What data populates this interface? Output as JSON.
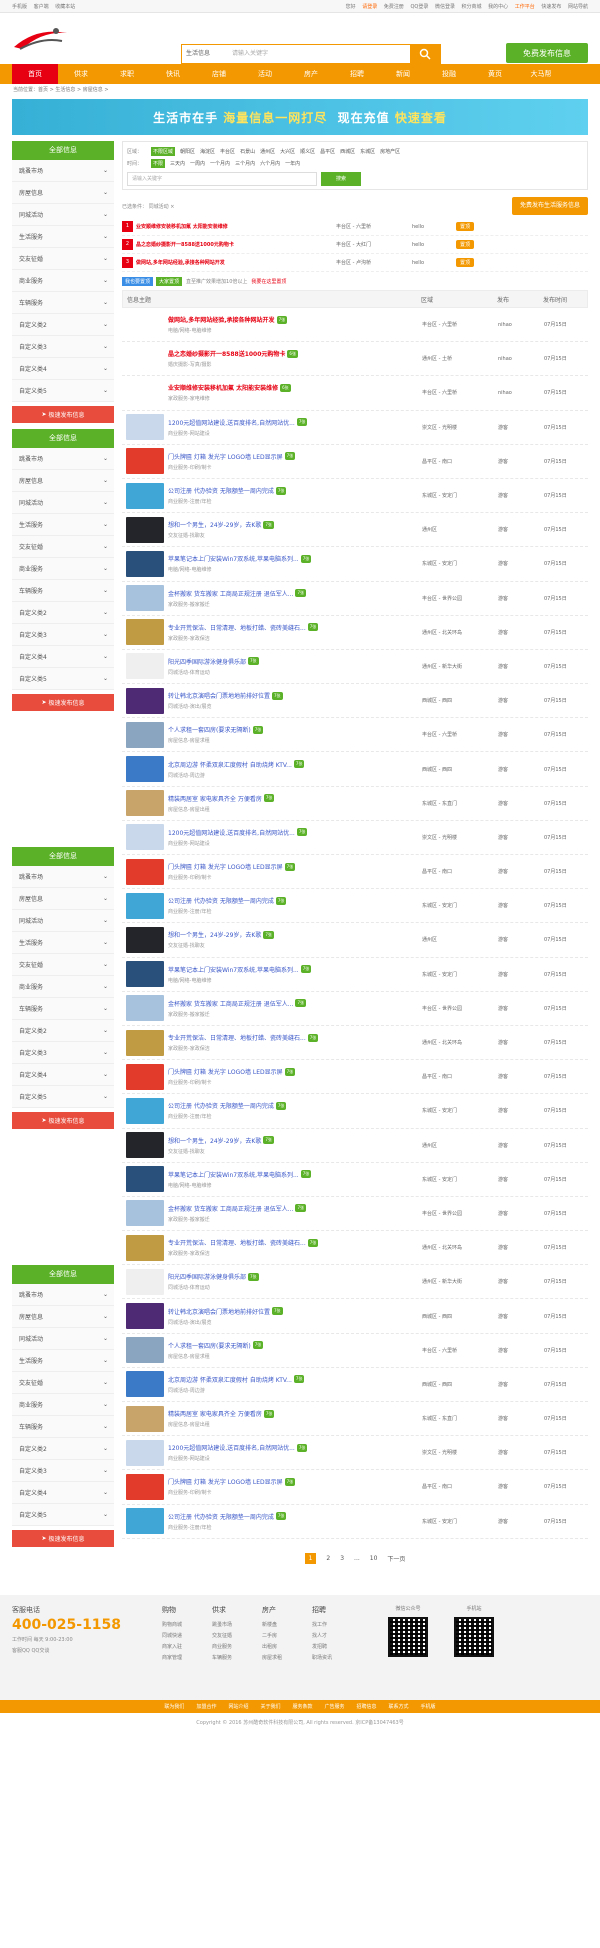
{
  "topbar": {
    "links": [
      "手机版",
      "客户端",
      "收藏本站"
    ],
    "right_links": [
      "您好",
      "请登录",
      "免费注册",
      "QQ登录",
      "微信登录",
      "积分商城",
      "我的中心",
      "工作平台",
      "快速发布",
      "网站导航"
    ]
  },
  "search": {
    "category": "生活信息",
    "placeholder": "请输入关键字"
  },
  "publish_top": "免费发布信息",
  "nav": [
    "首页",
    "供求",
    "求职",
    "快讯",
    "店铺",
    "活动",
    "房产",
    "招聘",
    "新闻",
    "投融",
    "黄页",
    "大马帮"
  ],
  "breadcrumb": "当前位置：首页 > 生活信息 > 房屋信息 >",
  "banner": {
    "a": "生活市在手",
    "b": "海量信息一网打尽",
    "c": "现在充值",
    "d": "快速查看"
  },
  "sidebar": {
    "head": "全部信息",
    "items": [
      "跳蚤市场",
      "房屋信息",
      "同城活动",
      "生活服务",
      "交友征婚",
      "商业服务",
      "车辆服务",
      "自定义类2",
      "自定义类3",
      "自定义类4",
      "自定义类5"
    ],
    "cta": "极速发布信息"
  },
  "filter": {
    "area_label": "区域：",
    "areas": [
      "不限区域",
      "朝阳区",
      "海淀区",
      "丰台区",
      "石景山",
      "通州区",
      "大兴区",
      "顺义区",
      "昌平区",
      "西城区",
      "东城区",
      "房地产区"
    ],
    "time_label": "时间：",
    "times": [
      "不限",
      "三天内",
      "一周内",
      "一个月内",
      "三个月内",
      "六个月内",
      "一年内"
    ],
    "search_placeholder": "请输入关键字",
    "search_button": "搜索"
  },
  "selected": {
    "label": "已选条件：",
    "value": "同城活动 ×"
  },
  "publish_cta": "免费发布生活服务信息",
  "top_rows": [
    {
      "n": "1",
      "title": "业安顺维修安装移机加氟 太阳能安装维修",
      "area": "丰台区 - 六里桥",
      "user": "hello",
      "pill": "置顶"
    },
    {
      "n": "2",
      "title": "晶之恋婚纱摄影开一8588送1000元购物卡",
      "area": "丰台区 - 大红门",
      "user": "hello",
      "pill": "置顶"
    },
    {
      "n": "3",
      "title": "做网站,多年网站经验,承接各种网站开发",
      "area": "丰台区 - 卢沟桥",
      "user": "hello",
      "pill": "置顶"
    }
  ],
  "ads": {
    "b1": "我也要置顶",
    "b2": "大家置顶",
    "hint": "直至推广效果增加10倍以上",
    "link": "我要在这里置顶"
  },
  "table_head": [
    "信息主题",
    "区域",
    "发布",
    "发布时间"
  ],
  "rows": [
    {
      "title": "做网站,多年网站经验,承接各种网站开发",
      "sub": "电脑/网络-电脑维修",
      "area": "丰台区 - 六里桥",
      "user": "nihao",
      "date": "07月15日",
      "hot": true,
      "tag": "7张",
      "color": "#ffffff"
    },
    {
      "title": "晶之恋婚纱摄影开一8588送1000元购物卡",
      "sub": "婚庆摄影-写真/摄影",
      "area": "通州区 - 土桥",
      "user": "nihao",
      "date": "07月15日",
      "hot": true,
      "tag": "6张",
      "color": "#ffffff"
    },
    {
      "title": "业安顺维修安装移机加氟 太阳能安装维修",
      "sub": "家政服务-家电维修",
      "area": "丰台区 - 六里桥",
      "user": "nihao",
      "date": "07月15日",
      "hot": true,
      "tag": "6张",
      "color": "#ffffff"
    },
    {
      "title": "1200元超值网站建设,送百度排名,自然网站优...",
      "sub": "商业服务-网站建设",
      "area": "崇文区 - 光明楼",
      "user": "游客",
      "date": "07月15日",
      "tag": "7张",
      "color": "#c9d8ea"
    },
    {
      "title": "门头牌匾 灯箱 发光字 LOGO墙 LED显示屏",
      "sub": "商业服务-印刷/制卡",
      "area": "昌平区 - 南口",
      "user": "游客",
      "date": "07月15日",
      "tag": "7张",
      "color": "#e23a2b"
    },
    {
      "title": "公司注册 代办验资 无限额垫一周内完成",
      "sub": "商业服务-注册/年检",
      "area": "东城区 - 安定门",
      "user": "游客",
      "date": "07月15日",
      "tag": "7张",
      "color": "#3fa6d6"
    },
    {
      "title": "想和一个男生，24岁-29岁，去K歌",
      "sub": "交友征婚-找聊友",
      "area": "通州区",
      "user": "游客",
      "date": "07月15日",
      "tag": "7张",
      "color": "#24252a"
    },
    {
      "title": "苹果笔记本上门安装Win7双系统,苹果电脑系列...",
      "sub": "电脑/网络-电脑维修",
      "area": "东城区 - 安定门",
      "user": "游客",
      "date": "07月15日",
      "tag": "7张",
      "color": "#28507a"
    },
    {
      "title": "金杯搬家 货车搬家 工商局正规注册 退伍军人...",
      "sub": "家政服务-搬家搬迁",
      "area": "丰台区 - 世界公园",
      "user": "游客",
      "date": "07月15日",
      "tag": "7张",
      "color": "#a7c2dd"
    },
    {
      "title": "专业开荒保洁、日常清理、地板打蜡、瓷砖美缝石...",
      "sub": "家政服务-家政保洁",
      "area": "通州区 - 北关环岛",
      "user": "游客",
      "date": "07月15日",
      "tag": "7张",
      "color": "#c19b43"
    },
    {
      "title": "阳光四季国际游泳健身俱乐部",
      "sub": "同城活动-体育运动",
      "area": "通州区 - 新华大街",
      "user": "游客",
      "date": "07月15日",
      "tag": "7张",
      "color": "#efefef"
    },
    {
      "title": "转让韩北京演唱会门票地地前排好位置",
      "sub": "同城活动-演出/展览",
      "area": "西城区 - 西四",
      "user": "游客",
      "date": "07月15日",
      "tag": "7张",
      "color": "#4d2a73"
    },
    {
      "title": "个人求租一套四房(要求无隔断)",
      "sub": "房屋信息-房屋求租",
      "area": "丰台区 - 六里桥",
      "user": "游客",
      "date": "07月15日",
      "tag": "7张",
      "color": "#8aa5c0"
    },
    {
      "title": "北京周边游 怀柔双泉汇度假村 自助烧烤 KTV...",
      "sub": "同城活动-周边游",
      "area": "西城区 - 西四",
      "user": "游客",
      "date": "07月15日",
      "tag": "7张",
      "color": "#3b7ac7"
    },
    {
      "title": "精装两居室 家电家具齐全 万便看房",
      "sub": "房屋信息-房屋出租",
      "area": "东城区 - 东直门",
      "user": "游客",
      "date": "07月15日",
      "tag": "7张",
      "color": "#c9a46a"
    },
    {
      "title": "1200元超值网站建设,送百度排名,自然网站优...",
      "sub": "商业服务-网站建设",
      "area": "崇文区 - 光明楼",
      "user": "游客",
      "date": "07月15日",
      "tag": "7张",
      "color": "#c9d8ea"
    },
    {
      "title": "门头牌匾 灯箱 发光字 LOGO墙 LED显示屏",
      "sub": "商业服务-印刷/制卡",
      "area": "昌平区 - 南口",
      "user": "游客",
      "date": "07月15日",
      "tag": "7张",
      "color": "#e23a2b"
    },
    {
      "title": "公司注册 代办验资 无限额垫一周内完成",
      "sub": "商业服务-注册/年检",
      "area": "东城区 - 安定门",
      "user": "游客",
      "date": "07月15日",
      "tag": "7张",
      "color": "#3fa6d6"
    },
    {
      "title": "想和一个男生，24岁-29岁，去K歌",
      "sub": "交友征婚-找聊友",
      "area": "通州区",
      "user": "游客",
      "date": "07月15日",
      "tag": "7张",
      "color": "#24252a"
    },
    {
      "title": "苹果笔记本上门安装Win7双系统,苹果电脑系列...",
      "sub": "电脑/网络-电脑维修",
      "area": "东城区 - 安定门",
      "user": "游客",
      "date": "07月15日",
      "tag": "7张",
      "color": "#28507a"
    },
    {
      "title": "金杯搬家 货车搬家 工商局正规注册 退伍军人...",
      "sub": "家政服务-搬家搬迁",
      "area": "丰台区 - 世界公园",
      "user": "游客",
      "date": "07月15日",
      "tag": "7张",
      "color": "#a7c2dd"
    },
    {
      "title": "专业开荒保洁、日常清理、地板打蜡、瓷砖美缝石...",
      "sub": "家政服务-家政保洁",
      "area": "通州区 - 北关环岛",
      "user": "游客",
      "date": "07月15日",
      "tag": "7张",
      "color": "#c19b43"
    },
    {
      "title": "门头牌匾 灯箱 发光字 LOGO墙 LED显示屏",
      "sub": "商业服务-印刷/制卡",
      "area": "昌平区 - 南口",
      "user": "游客",
      "date": "07月15日",
      "tag": "7张",
      "color": "#e23a2b"
    },
    {
      "title": "公司注册 代办验资 无限额垫一周内完成",
      "sub": "商业服务-注册/年检",
      "area": "东城区 - 安定门",
      "user": "游客",
      "date": "07月15日",
      "tag": "7张",
      "color": "#3fa6d6"
    },
    {
      "title": "想和一个男生，24岁-29岁，去K歌",
      "sub": "交友征婚-找聊友",
      "area": "通州区",
      "user": "游客",
      "date": "07月15日",
      "tag": "7张",
      "color": "#24252a"
    },
    {
      "title": "苹果笔记本上门安装Win7双系统,苹果电脑系列...",
      "sub": "电脑/网络-电脑维修",
      "area": "东城区 - 安定门",
      "user": "游客",
      "date": "07月15日",
      "tag": "7张",
      "color": "#28507a"
    },
    {
      "title": "金杯搬家 货车搬家 工商局正规注册 退伍军人...",
      "sub": "家政服务-搬家搬迁",
      "area": "丰台区 - 世界公园",
      "user": "游客",
      "date": "07月15日",
      "tag": "7张",
      "color": "#a7c2dd"
    },
    {
      "title": "专业开荒保洁、日常清理、地板打蜡、瓷砖美缝石...",
      "sub": "家政服务-家政保洁",
      "area": "通州区 - 北关环岛",
      "user": "游客",
      "date": "07月15日",
      "tag": "7张",
      "color": "#c19b43"
    },
    {
      "title": "阳光四季国际游泳健身俱乐部",
      "sub": "同城活动-体育运动",
      "area": "通州区 - 新华大街",
      "user": "游客",
      "date": "07月15日",
      "tag": "7张",
      "color": "#efefef"
    },
    {
      "title": "转让韩北京演唱会门票地地前排好位置",
      "sub": "同城活动-演出/展览",
      "area": "西城区 - 西四",
      "user": "游客",
      "date": "07月15日",
      "tag": "7张",
      "color": "#4d2a73"
    },
    {
      "title": "个人求租一套四房(要求无隔断)",
      "sub": "房屋信息-房屋求租",
      "area": "丰台区 - 六里桥",
      "user": "游客",
      "date": "07月15日",
      "tag": "7张",
      "color": "#8aa5c0"
    },
    {
      "title": "北京周边游 怀柔双泉汇度假村 自助烧烤 KTV...",
      "sub": "同城活动-周边游",
      "area": "西城区 - 西四",
      "user": "游客",
      "date": "07月15日",
      "tag": "7张",
      "color": "#3b7ac7"
    },
    {
      "title": "精装两居室 家电家具齐全 万便看房",
      "sub": "房屋信息-房屋出租",
      "area": "东城区 - 东直门",
      "user": "游客",
      "date": "07月15日",
      "tag": "7张",
      "color": "#c9a46a"
    },
    {
      "title": "1200元超值网站建设,送百度排名,自然网站优...",
      "sub": "商业服务-网站建设",
      "area": "崇文区 - 光明楼",
      "user": "游客",
      "date": "07月15日",
      "tag": "7张",
      "color": "#c9d8ea"
    },
    {
      "title": "门头牌匾 灯箱 发光字 LOGO墙 LED显示屏",
      "sub": "商业服务-印刷/制卡",
      "area": "昌平区 - 南口",
      "user": "游客",
      "date": "07月15日",
      "tag": "7张",
      "color": "#e23a2b"
    },
    {
      "title": "公司注册 代办验资 无限额垫一周内完成",
      "sub": "商业服务-注册/年检",
      "area": "东城区 - 安定门",
      "user": "游客",
      "date": "07月15日",
      "tag": "7张",
      "color": "#3fa6d6"
    }
  ],
  "pager": [
    "1",
    "2",
    "3",
    "...",
    "10",
    "下一页"
  ],
  "footer": {
    "hotline_label": "客服电话",
    "hotline": "400-025-1158",
    "hours": "工作时间 每天 9:00-23:00",
    "qq": "客服QQ  QQ交谈",
    "cols": [
      {
        "h": "购物",
        "items": [
          "购物商城",
          "同城快递",
          "商家入驻",
          "商家管理"
        ]
      },
      {
        "h": "供求",
        "items": [
          "跳蚤市场",
          "交友征婚",
          "商业服务",
          "车辆服务"
        ]
      },
      {
        "h": "房产",
        "items": [
          "新楼盘",
          "二手房",
          "出租房",
          "房屋求租"
        ]
      },
      {
        "h": "招聘",
        "items": [
          "找工作",
          "找人才",
          "发招聘",
          "职场资讯"
        ]
      }
    ],
    "qr1": "微信公众号",
    "qr2": "手机站",
    "nav": [
      "联为我们",
      "加盟合作",
      "网站介绍",
      "关于我们",
      "服务条款",
      "广告服务",
      "招聘信息",
      "联系方式",
      "手机版"
    ],
    "copyright": "Copyright © 2016 苏州酷奇软件科技有限公司, All rights reserved. 京ICP备13047463号"
  },
  "colors": {
    "orange": "#f39800",
    "green": "#5bb127",
    "red": "#e60012"
  }
}
